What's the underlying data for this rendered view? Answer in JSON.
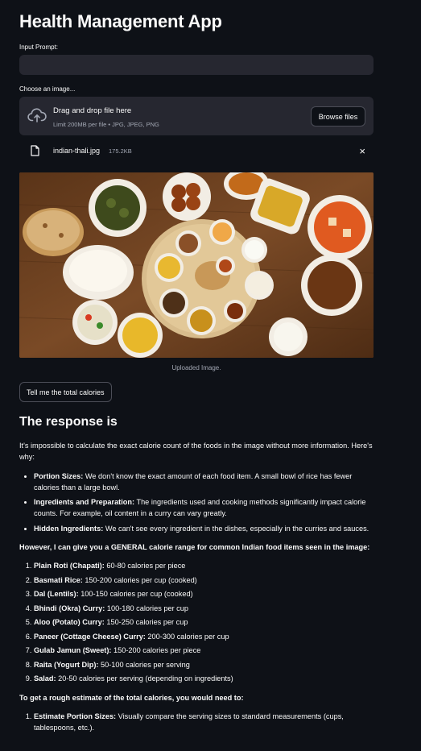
{
  "app": {
    "title": "Health Management App"
  },
  "prompt": {
    "label": "Input Prompt:",
    "value": "",
    "placeholder": ""
  },
  "uploader": {
    "label": "Choose an image...",
    "dropzone_title": "Drag and drop file here",
    "dropzone_limit": "Limit 200MB per file • JPG, JPEG, PNG",
    "browse_label": "Browse files",
    "file_name": "indian-thali.jpg",
    "file_size": "175.2KB",
    "close_glyph": "×"
  },
  "image": {
    "caption": "Uploaded Image."
  },
  "action": {
    "button_label": "Tell me the total calories"
  },
  "response": {
    "heading": "The response is",
    "intro": "It's impossible to calculate the exact calorie count of the foods in the image without more information. Here's why:",
    "reasons": [
      {
        "title": "Portion Sizes:",
        "text": " We don't know the exact amount of each food item. A small bowl of rice has fewer calories than a large bowl."
      },
      {
        "title": "Ingredients and Preparation:",
        "text": " The ingredients used and cooking methods significantly impact calorie counts. For example, oil content in a curry can vary greatly."
      },
      {
        "title": "Hidden Ingredients:",
        "text": " We can't see every ingredient in the dishes, especially in the curries and sauces."
      }
    ],
    "range_heading": "However, I can give you a GENERAL calorie range for common Indian food items seen in the image:",
    "items": [
      {
        "title": "Plain Roti (Chapati):",
        "text": " 60-80 calories per piece"
      },
      {
        "title": "Basmati Rice:",
        "text": " 150-200 calories per cup (cooked)"
      },
      {
        "title": "Dal (Lentils):",
        "text": " 100-150 calories per cup (cooked)"
      },
      {
        "title": "Bhindi (Okra) Curry:",
        "text": " 100-180 calories per cup"
      },
      {
        "title": "Aloo (Potato) Curry:",
        "text": " 150-250 calories per cup"
      },
      {
        "title": "Paneer (Cottage Cheese) Curry:",
        "text": " 200-300 calories per cup"
      },
      {
        "title": "Gulab Jamun (Sweet):",
        "text": " 150-200 calories per piece"
      },
      {
        "title": "Raita (Yogurt Dip):",
        "text": " 50-100 calories per serving"
      },
      {
        "title": "Salad:",
        "text": " 20-50 calories per serving (depending on ingredients)"
      }
    ],
    "estimate_heading": "To get a rough estimate of the total calories, you would need to:",
    "steps": [
      {
        "title": "Estimate Portion Sizes:",
        "text": " Visually compare the serving sizes to standard measurements (cups, tablespoons, etc.)."
      }
    ]
  },
  "colors": {
    "background": "#0e1117",
    "input_bg": "#262730",
    "text": "#fafafa",
    "muted": "#a3a8b4",
    "button_border": "#4b4d57"
  },
  "icons": {
    "upload": "cloud-upload-icon",
    "file": "file-icon",
    "close": "close-icon"
  }
}
